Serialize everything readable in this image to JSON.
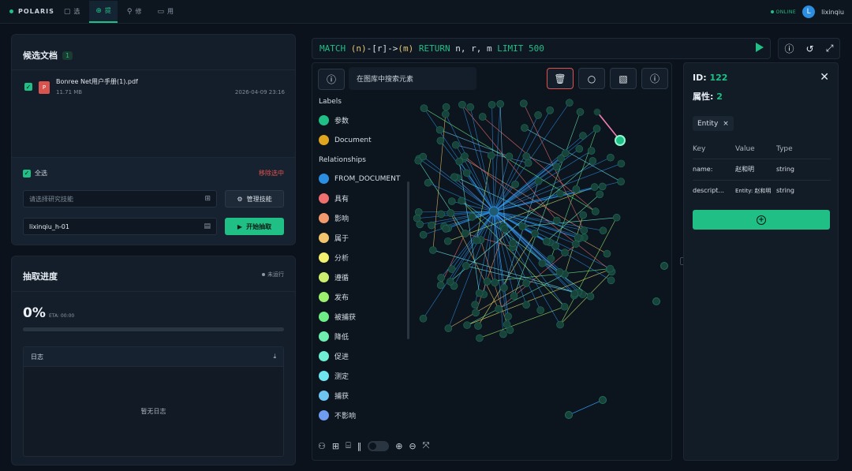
{
  "brand": "POLARIS",
  "nav": [
    {
      "icon": "▢",
      "label": "选"
    },
    {
      "icon": "⊕",
      "label": "提"
    },
    {
      "icon": "⚲",
      "label": "修"
    },
    {
      "icon": "▭",
      "label": "用"
    }
  ],
  "status": "ONLINE",
  "user": {
    "initial": "L",
    "name": "lixinqiu"
  },
  "docs": {
    "title": "候选文档",
    "count": "1",
    "file": {
      "name": "Bonree Net用户手册(1).pdf",
      "size": "11.71 MB",
      "date": "2026-04-09 23:16",
      "icon_text": "P"
    },
    "select_all": "全选",
    "remove_selected": "移除选中",
    "skill_placeholder": "请选择研究技能",
    "manage_skill": "管理技能",
    "task_name": "lixinqiu_h-01",
    "start_extract": "开始抽取"
  },
  "progress": {
    "title": "抽取进度",
    "state": "未运行",
    "percent": "0%",
    "percent_value": 0,
    "eta": "ETA: 00:00",
    "log_title": "日志",
    "log_empty": "暂无日志"
  },
  "query": {
    "p1": "MATCH",
    "p2": "(n)",
    "p3": "-[r]->",
    "p4": "(m)",
    "p5": "RETURN",
    "p6": "n, r, m",
    "p7": "LIMIT",
    "p8": "500"
  },
  "graph": {
    "search_placeholder": "在图库中搜索元素",
    "labels_title": "Labels",
    "labels": [
      {
        "name": "参数",
        "color": "#1fbf86"
      },
      {
        "name": "Document",
        "color": "#e0a51e"
      }
    ],
    "relationships_title": "Relationships",
    "relationships": [
      {
        "name": "FROM_DOCUMENT",
        "color": "#2b8ee0"
      },
      {
        "name": "具有",
        "color": "#f07070"
      },
      {
        "name": "影响",
        "color": "#f29a6e"
      },
      {
        "name": "属于",
        "color": "#f2c46e"
      },
      {
        "name": "分析",
        "color": "#f2f06e"
      },
      {
        "name": "遵循",
        "color": "#cdef6e"
      },
      {
        "name": "发布",
        "color": "#9cef6e"
      },
      {
        "name": "被捕获",
        "color": "#6eef86"
      },
      {
        "name": "降低",
        "color": "#6eefb0"
      },
      {
        "name": "促进",
        "color": "#6eefd3"
      },
      {
        "name": "测定",
        "color": "#6ee6ef"
      },
      {
        "name": "捕获",
        "color": "#6ec5ef"
      },
      {
        "name": "不影响",
        "color": "#6e9cef"
      }
    ]
  },
  "detail": {
    "id_label": "ID:",
    "id_value": "122",
    "props_label": "属性:",
    "props_value": "2",
    "chip": "Entity",
    "columns": [
      "Key",
      "Value",
      "Type"
    ],
    "rows": [
      {
        "key": "name:",
        "value": "赵和明",
        "type": "string"
      },
      {
        "key": "descript...",
        "value": "Entity: 赵和明",
        "type": "string"
      }
    ]
  }
}
